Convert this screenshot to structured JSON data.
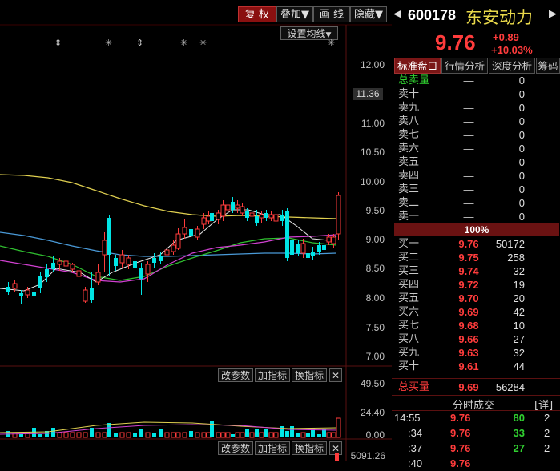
{
  "toolbar": {
    "buttons": [
      "复 权",
      "叠加",
      "画 线",
      "隐藏"
    ],
    "ma_settings": "设置均线"
  },
  "price_axis": {
    "ticks": [
      "12.00",
      "11.00",
      "10.50",
      "10.00",
      "9.50",
      "9.00",
      "8.50",
      "8.00",
      "7.50",
      "7.00"
    ],
    "current_tag": "11.36"
  },
  "indicator_panels": [
    {
      "ticks": [
        "49.50",
        "24.40",
        "0.00"
      ],
      "buttons": [
        "改参数",
        "加指标",
        "换指标"
      ]
    },
    {
      "ticks": [
        "5091.26"
      ],
      "buttons": [
        "改参数",
        "加指标",
        "换指标"
      ]
    }
  ],
  "stock": {
    "code": "600178",
    "name": "东安动力",
    "price": "9.76",
    "change": "+0.89",
    "change_pct": "+10.03%"
  },
  "tabs": [
    "标准盘口",
    "行情分析",
    "深度分析",
    "筹码"
  ],
  "order_book": {
    "total_sell_label": "总卖量",
    "total_sell_price": "—",
    "total_sell_vol": "0",
    "asks": [
      {
        "label": "卖十",
        "price": "—",
        "vol": "0"
      },
      {
        "label": "卖九",
        "price": "—",
        "vol": "0"
      },
      {
        "label": "卖八",
        "price": "—",
        "vol": "0"
      },
      {
        "label": "卖七",
        "price": "—",
        "vol": "0"
      },
      {
        "label": "卖六",
        "price": "—",
        "vol": "0"
      },
      {
        "label": "卖五",
        "price": "—",
        "vol": "0"
      },
      {
        "label": "卖四",
        "price": "—",
        "vol": "0"
      },
      {
        "label": "卖三",
        "price": "—",
        "vol": "0"
      },
      {
        "label": "卖二",
        "price": "—",
        "vol": "0"
      },
      {
        "label": "卖一",
        "price": "—",
        "vol": "0"
      }
    ],
    "ratio": "100%",
    "bids": [
      {
        "label": "买一",
        "price": "9.76",
        "vol": "50172"
      },
      {
        "label": "买二",
        "price": "9.75",
        "vol": "258"
      },
      {
        "label": "买三",
        "price": "9.74",
        "vol": "32"
      },
      {
        "label": "买四",
        "price": "9.72",
        "vol": "19"
      },
      {
        "label": "买五",
        "price": "9.70",
        "vol": "20"
      },
      {
        "label": "买六",
        "price": "9.69",
        "vol": "42"
      },
      {
        "label": "买七",
        "price": "9.68",
        "vol": "10"
      },
      {
        "label": "买八",
        "price": "9.66",
        "vol": "27"
      },
      {
        "label": "买九",
        "price": "9.63",
        "vol": "32"
      },
      {
        "label": "买十",
        "price": "9.61",
        "vol": "44"
      }
    ],
    "total_buy_label": "总买量",
    "total_buy_price": "9.69",
    "total_buy_vol": "56284"
  },
  "trades": {
    "title": "分时成交",
    "detail_btn": "[详]",
    "rows": [
      {
        "time": "14:55",
        "price": "9.76",
        "vol": "80",
        "n": "2"
      },
      {
        "time": ":34",
        "price": "9.76",
        "vol": "33",
        "n": "2"
      },
      {
        "time": ":37",
        "price": "9.76",
        "vol": "27",
        "n": "2"
      },
      {
        "time": ":40",
        "price": "9.76",
        "vol": "",
        "n": ""
      }
    ]
  },
  "colors": {
    "up": "#ff3c3c",
    "down": "#00e5e5",
    "accent_red": "#8a1010",
    "price_yellow": "#e8d84a"
  }
}
